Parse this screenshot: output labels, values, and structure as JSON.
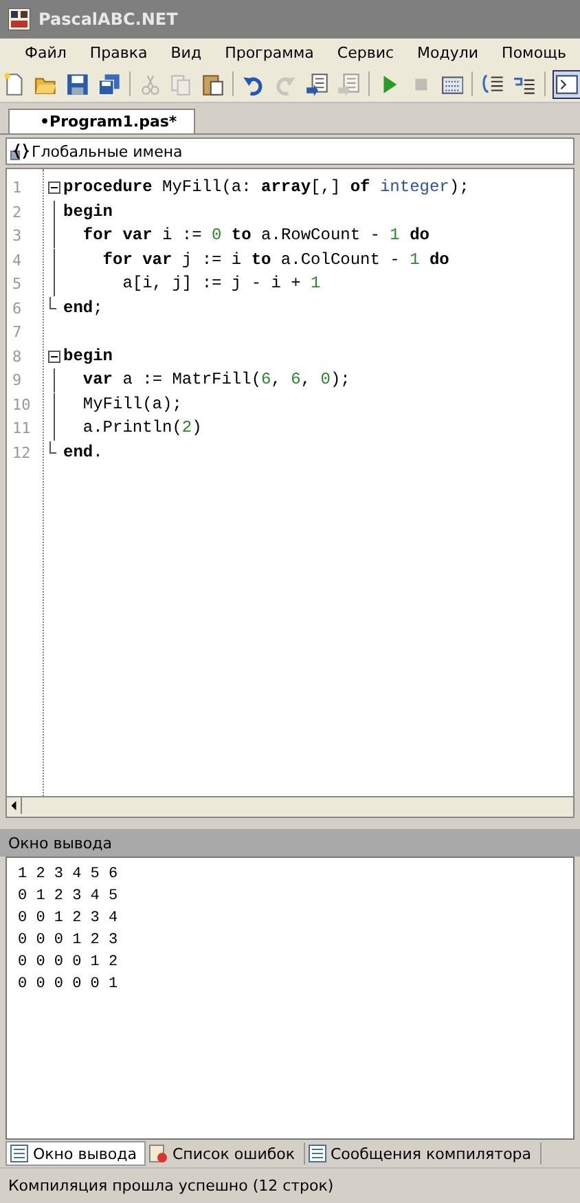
{
  "window": {
    "title": "PascalABC.NET"
  },
  "menu": [
    "Файл",
    "Правка",
    "Вид",
    "Программа",
    "Сервис",
    "Модули",
    "Помощь"
  ],
  "toolbar": [
    {
      "kind": "new",
      "disabled": false
    },
    {
      "kind": "open",
      "disabled": false
    },
    {
      "kind": "save",
      "disabled": false
    },
    {
      "kind": "saveall",
      "disabled": false
    },
    {
      "kind": "sep"
    },
    {
      "kind": "cut",
      "disabled": true
    },
    {
      "kind": "copy",
      "disabled": true
    },
    {
      "kind": "paste",
      "disabled": false
    },
    {
      "kind": "sep"
    },
    {
      "kind": "undo",
      "disabled": false
    },
    {
      "kind": "redo",
      "disabled": true
    },
    {
      "kind": "doc",
      "disabled": false
    },
    {
      "kind": "doc",
      "disabled": true
    },
    {
      "kind": "sep"
    },
    {
      "kind": "run",
      "disabled": false
    },
    {
      "kind": "stop",
      "disabled": true
    },
    {
      "kind": "compile",
      "disabled": false
    },
    {
      "kind": "sep"
    },
    {
      "kind": "stepin",
      "disabled": false
    },
    {
      "kind": "stepover",
      "disabled": false
    },
    {
      "kind": "sep"
    },
    {
      "kind": "console",
      "disabled": false
    }
  ],
  "tabs": [
    {
      "label": "•Program1.pas*",
      "selected": true
    }
  ],
  "scope_dropdown": {
    "value": "Глобальные имена"
  },
  "editor": {
    "lines": [
      {
        "number": "1",
        "fold_expanded": true,
        "tokens": [
          {
            "kind": "kw",
            "text": "procedure"
          },
          {
            "kind": "plain",
            "text": " MyFill(a: "
          },
          {
            "kind": "kw",
            "text": "array"
          },
          {
            "kind": "plain",
            "text": "[,] "
          },
          {
            "kind": "kw",
            "text": "of"
          },
          {
            "kind": "type",
            "text": " integer"
          },
          {
            "kind": "plain",
            "text": ");"
          }
        ]
      },
      {
        "number": "2",
        "tokens": [
          {
            "kind": "kw",
            "text": "begin"
          }
        ]
      },
      {
        "number": "3",
        "tokens": [
          {
            "kind": "kw",
            "text": "  for var"
          },
          {
            "kind": "plain",
            "text": " i := "
          },
          {
            "kind": "num",
            "text": "0"
          },
          {
            "kind": "kw",
            "text": " to"
          },
          {
            "kind": "plain",
            "text": " a.RowCount - "
          },
          {
            "kind": "num",
            "text": "1"
          },
          {
            "kind": "kw",
            "text": " do"
          }
        ]
      },
      {
        "number": "4",
        "tokens": [
          {
            "kind": "kw",
            "text": "    for var"
          },
          {
            "kind": "plain",
            "text": " j := i "
          },
          {
            "kind": "kw",
            "text": "to"
          },
          {
            "kind": "plain",
            "text": " a.ColCount - "
          },
          {
            "kind": "num",
            "text": "1"
          },
          {
            "kind": "kw",
            "text": " do"
          }
        ]
      },
      {
        "number": "5",
        "tokens": [
          {
            "kind": "plain",
            "text": "      a[i, j] := j - i + "
          },
          {
            "kind": "num",
            "text": "1"
          }
        ]
      },
      {
        "number": "6",
        "block_end": true,
        "tokens": [
          {
            "kind": "kw",
            "text": "end"
          },
          {
            "kind": "plain",
            "text": ";"
          }
        ]
      },
      {
        "number": "7"
      },
      {
        "number": "8",
        "fold_expanded": true,
        "tokens": [
          {
            "kind": "kw",
            "text": "begin"
          }
        ]
      },
      {
        "number": "9",
        "tokens": [
          {
            "kind": "kw",
            "text": "  var"
          },
          {
            "kind": "plain",
            "text": " a := MatrFill("
          },
          {
            "kind": "num",
            "text": "6"
          },
          {
            "kind": "plain",
            "text": ", "
          },
          {
            "kind": "num",
            "text": "6"
          },
          {
            "kind": "plain",
            "text": ", "
          },
          {
            "kind": "num",
            "text": "0"
          },
          {
            "kind": "plain",
            "text": ");"
          }
        ]
      },
      {
        "number": "10",
        "tokens": [
          {
            "kind": "plain",
            "text": "  MyFill(a);"
          }
        ]
      },
      {
        "number": "11",
        "tokens": [
          {
            "kind": "plain",
            "text": "  a.Println("
          },
          {
            "kind": "num",
            "text": "2"
          },
          {
            "kind": "plain",
            "text": ")"
          }
        ]
      },
      {
        "number": "12",
        "block_end": true,
        "tokens": [
          {
            "kind": "kw",
            "text": "end"
          },
          {
            "kind": "plain",
            "text": "."
          }
        ]
      }
    ]
  },
  "output_panel": {
    "title": "Окно вывода",
    "lines": [
      "1 2 3 4 5 6",
      "0 1 2 3 4 5",
      "0 0 1 2 3 4",
      "0 0 0 1 2 3",
      "0 0 0 0 1 2",
      "0 0 0 0 0 1"
    ]
  },
  "bottom_tabs": [
    {
      "label": "Окно вывода",
      "kind": "output",
      "selected": true
    },
    {
      "label": "Список ошибок",
      "kind": "errors",
      "selected": false
    },
    {
      "label": "Сообщения компилятора",
      "kind": "messages",
      "selected": false
    }
  ],
  "status_bar": "Компиляция прошла успешно (12 строк)"
}
